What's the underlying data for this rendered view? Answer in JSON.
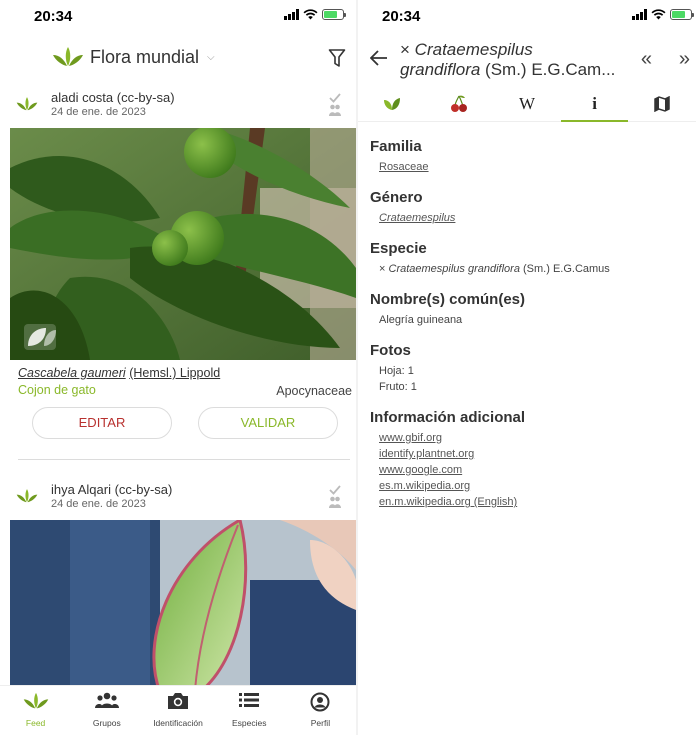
{
  "status_bar": {
    "time": "20:34"
  },
  "left": {
    "header": {
      "title": "Flora mundial"
    },
    "posts": [
      {
        "author": "aladi costa (cc-by-sa)",
        "date": "24 de ene. de 2023",
        "genus_species": "Cascabela gaumeri",
        "authority": "(Hemsl.) Lippold",
        "common_name": "Cojon de gato",
        "family": "Apocynaceae",
        "edit_label": "EDITAR",
        "validate_label": "VALIDAR"
      },
      {
        "author": "ihya Alqari (cc-by-sa)",
        "date": "24 de ene. de 2023"
      }
    ],
    "bottom_nav": [
      {
        "label": "Feed",
        "icon": "leaf-icon",
        "active": true
      },
      {
        "label": "Grupos",
        "icon": "group-icon"
      },
      {
        "label": "Identificación",
        "icon": "camera-icon"
      },
      {
        "label": "Especies",
        "icon": "list-icon"
      },
      {
        "label": "Perfil",
        "icon": "profile-icon"
      }
    ]
  },
  "right": {
    "title_prefix": "×",
    "title_genus": "Crataemespilus",
    "title_line2_genus": "grandiflora",
    "title_line2_rest": " (Sm.) E.G.Cam...",
    "tabs": [
      {
        "icon": "leaf-icon"
      },
      {
        "icon": "cherry-icon"
      },
      {
        "label": "W",
        "icon": "wikipedia-icon"
      },
      {
        "label": "i",
        "icon": "info-icon",
        "active": true
      },
      {
        "icon": "map-icon"
      }
    ],
    "sections": {
      "familia": {
        "heading": "Familia",
        "value": "Rosaceae"
      },
      "genero": {
        "heading": "Género",
        "value": "Crataemespilus"
      },
      "especie": {
        "heading": "Especie",
        "prefix": "×",
        "value_italic": "Crataemespilus grandiflora",
        "value_rest": " (Sm.) E.G.Camus"
      },
      "nombres": {
        "heading": "Nombre(s) común(es)",
        "value": "Alegría guineana"
      },
      "fotos": {
        "heading": "Fotos",
        "hoja": "Hoja: 1",
        "fruto": "Fruto: 1"
      },
      "info": {
        "heading": "Información adicional",
        "links": [
          "www.gbif.org",
          "identify.plantnet.org",
          "www.google.com",
          "es.m.wikipedia.org",
          "en.m.wikipedia.org (English)"
        ]
      }
    }
  }
}
